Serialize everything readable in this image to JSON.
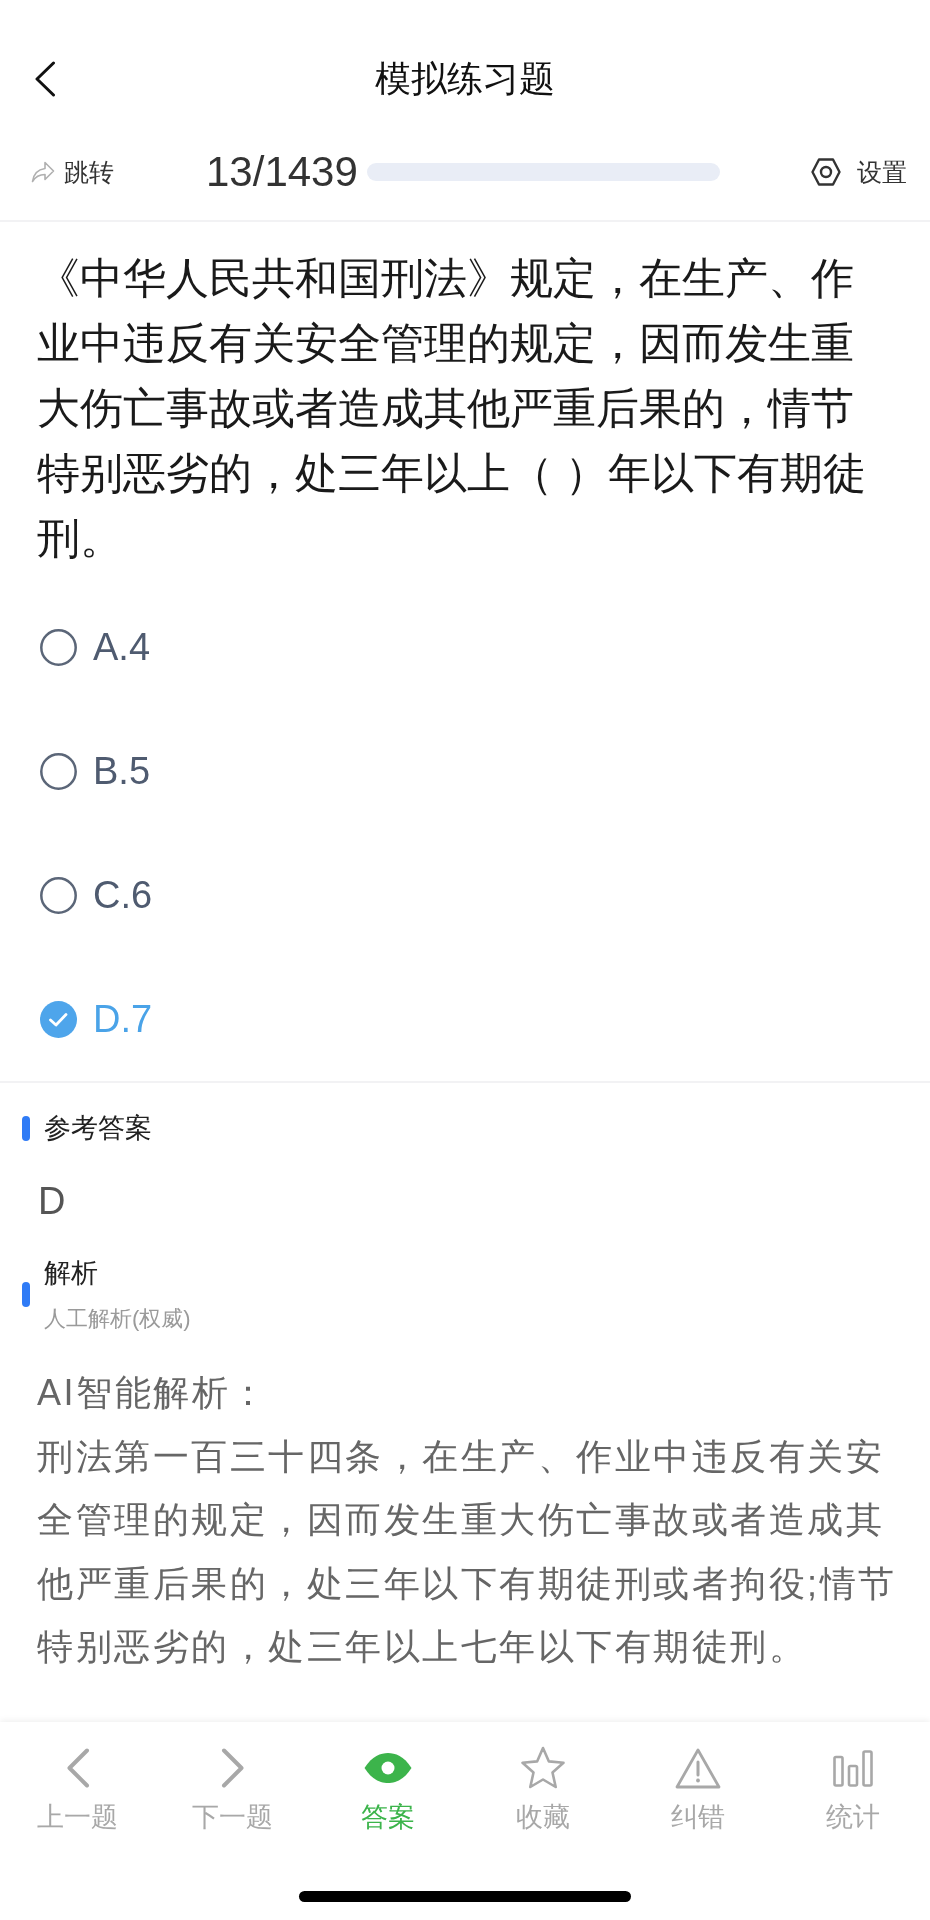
{
  "nav_bar": {
    "title": "模拟练习题"
  },
  "toolbar": {
    "jump": "跳转",
    "counter": "13/1439",
    "progress": {
      "level": 0
    },
    "settings": "设置"
  },
  "question": {
    "text": "《中华人民共和国刑法》规定，在生产、作业中违反有关安全管理的规定，因而发生重大伤亡事故或者造成其他严重后果的，情节特别恶劣的，处三年以上（ ）年以下有期徒刑。"
  },
  "options": [
    {
      "label": "A.4",
      "selected": false
    },
    {
      "label": "B.5",
      "selected": false
    },
    {
      "label": "C.6",
      "selected": false
    },
    {
      "label": "D.7",
      "selected": true
    }
  ],
  "reference_answer": {
    "title": "参考答案",
    "answer": "D"
  },
  "analysis": {
    "title": "解析",
    "subtitle": "人工解析(权威)",
    "heading": "AI智能解析：",
    "body": "刑法第一百三十四条，在生产、作业中违反有关安全管理的规定，因而发生重大伤亡事故或者造成其他严重后果的，处三年以下有期徒刑或者拘役;情节特别恶劣的，处三年以上七年以下有期徒刑。"
  },
  "tab_bar": [
    {
      "label": "上一题",
      "selected": false
    },
    {
      "label": "下一题",
      "selected": false
    },
    {
      "label": "答案",
      "selected": true
    },
    {
      "label": "收藏",
      "selected": false
    },
    {
      "label": "纠错",
      "selected": false
    },
    {
      "label": "统计",
      "selected": false
    }
  ]
}
